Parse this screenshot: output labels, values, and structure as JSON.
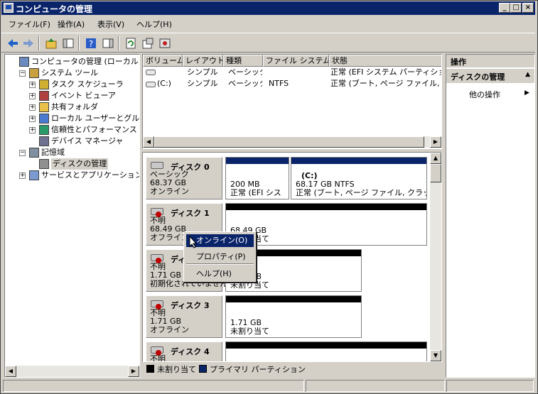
{
  "window": {
    "title": "コンピュータの管理"
  },
  "menu": [
    "ファイル(F)",
    "操作(A)",
    "表示(V)",
    "ヘルプ(H)"
  ],
  "tree": [
    {
      "label": "コンピュータの管理 (ローカル)",
      "indent": 0,
      "expander": "",
      "icon": "computer-management-icon"
    },
    {
      "label": "システム ツール",
      "indent": 1,
      "expander": "−",
      "icon": "system-tools-icon"
    },
    {
      "label": "タスク スケジューラ",
      "indent": 2,
      "expander": "+",
      "icon": "task-scheduler-icon"
    },
    {
      "label": "イベント ビューア",
      "indent": 2,
      "expander": "+",
      "icon": "event-viewer-icon"
    },
    {
      "label": "共有フォルダ",
      "indent": 2,
      "expander": "+",
      "icon": "shared-folders-icon"
    },
    {
      "label": "ローカル ユーザーとグループ",
      "indent": 2,
      "expander": "+",
      "icon": "local-users-icon"
    },
    {
      "label": "信頼性とパフォーマンス",
      "indent": 2,
      "expander": "+",
      "icon": "reliability-performance-icon"
    },
    {
      "label": "デバイス マネージャ",
      "indent": 2,
      "expander": "",
      "icon": "device-manager-icon"
    },
    {
      "label": "記憶域",
      "indent": 1,
      "expander": "−",
      "icon": "storage-icon"
    },
    {
      "label": "ディスクの管理",
      "indent": 2,
      "expander": "",
      "icon": "disk-management-icon",
      "selected": true
    },
    {
      "label": "サービスとアプリケーション",
      "indent": 1,
      "expander": "+",
      "icon": "services-apps-icon"
    }
  ],
  "volume_list": {
    "columns": [
      "ボリューム",
      "レイアウト",
      "種類",
      "ファイル システム",
      "状態"
    ],
    "rows": [
      [
        "",
        "シンプル",
        "ベーシック",
        "",
        "正常 (EFI システム パーティション)"
      ],
      [
        "(C:)",
        "シンプル",
        "ベーシック",
        "NTFS",
        "正常 (ブート, ページ ファイル, クラッシュ ダンプ)"
      ]
    ]
  },
  "disks": [
    {
      "name": "ディスク 0",
      "lines": [
        "ベーシック",
        "68.37 GB",
        "オンライン"
      ],
      "error": false,
      "partitions": [
        {
          "lines": [
            "200 MB",
            "正常 (EFI シス"
          ],
          "kind": "primary"
        },
        {
          "lines": [
            "(C:)",
            "68.17 GB NTFS",
            "正常 (ブート, ページ ファイル, クラッシュ"
          ],
          "kind": "primary"
        }
      ]
    },
    {
      "name": "ディスク 1",
      "lines": [
        "不明",
        "68.49 GB",
        "オフライン"
      ],
      "error": true,
      "partitions": [
        {
          "lines": [
            "68.49 GB",
            "未割り当て"
          ],
          "kind": "unallocated"
        }
      ]
    },
    {
      "name": "ディスク 2",
      "lines": [
        "不明",
        "1.71 GB",
        "初期化されていません"
      ],
      "error": true,
      "partitions": [
        {
          "lines": [
            "1.71 GB",
            "未割り当て"
          ],
          "kind": "unallocated"
        }
      ]
    },
    {
      "name": "ディスク 3",
      "lines": [
        "不明",
        "1.71 GB",
        "オフライン"
      ],
      "error": true,
      "partitions": [
        {
          "lines": [
            "1.71 GB",
            "未割り当て"
          ],
          "kind": "unallocated"
        }
      ]
    },
    {
      "name": "ディスク 4",
      "lines": [
        "不明"
      ],
      "error": true,
      "partitions": [
        {
          "lines": [],
          "kind": "unallocated"
        }
      ]
    }
  ],
  "legend": {
    "unallocated": "未割り当て",
    "primary": "プライマリ パーティション"
  },
  "context_menu": [
    {
      "label": "オンライン(O)",
      "highlighted": true
    },
    {
      "label": "プロパティ(P)",
      "highlighted": false
    },
    {
      "label": "ヘルプ(H)",
      "highlighted": false
    }
  ],
  "actions": {
    "header": "操作",
    "section": "ディスクの管理",
    "more": "他の操作"
  },
  "colors": {
    "titlebar": "#0a246a",
    "primary": "#0a246a",
    "unallocated": "#000000",
    "selection": "#0a246a"
  }
}
